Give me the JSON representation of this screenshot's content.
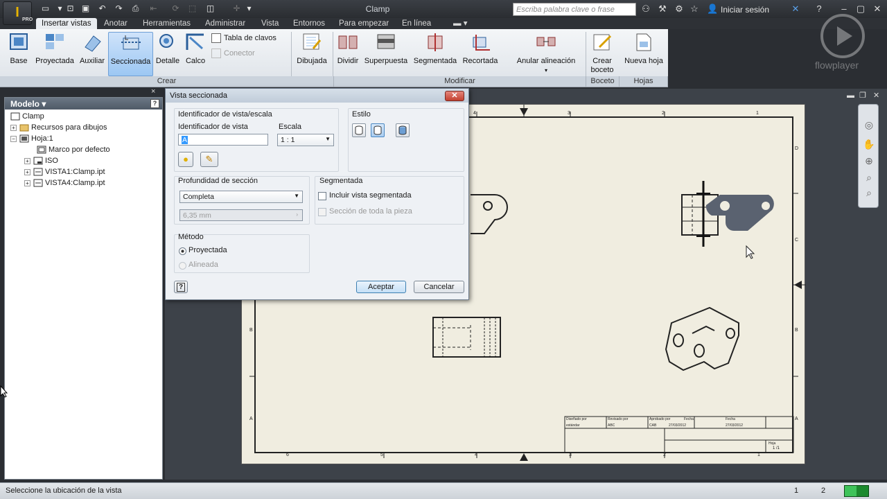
{
  "app": {
    "logo_letter": "I",
    "logo_badge": "PRO",
    "window_title": "Clamp"
  },
  "search": {
    "placeholder": "Escriba palabra clave o frase"
  },
  "signin": "Iniciar sesión",
  "tabs": [
    {
      "label": "Insertar vistas",
      "active": true
    },
    {
      "label": "Anotar"
    },
    {
      "label": "Herramientas"
    },
    {
      "label": "Administrar"
    },
    {
      "label": "Vista"
    },
    {
      "label": "Entornos"
    },
    {
      "label": "Para empezar"
    },
    {
      "label": "En línea"
    }
  ],
  "ribbon": {
    "buttons": [
      "Base",
      "Proyectada",
      "Auxiliar",
      "Seccionada",
      "Detalle",
      "Calco",
      "Dibujada",
      "Dividir",
      "Superpuesta",
      "Segmentada",
      "Recortada",
      "Anular alineación",
      "Crear",
      "boceto",
      "Nueva hoja"
    ],
    "small": [
      "Tabla de clavos",
      "Conector"
    ],
    "groups": [
      "Crear",
      "Modificar",
      "Boceto",
      "Hojas"
    ]
  },
  "watermark": "flowplayer",
  "browser": {
    "title": "Modelo ▾",
    "items": [
      "Clamp",
      "Recursos para dibujos",
      "Hoja:1",
      "Marco por defecto",
      "ISO",
      "VISTA1:Clamp.ipt",
      "VISTA4:Clamp.ipt"
    ]
  },
  "dialog": {
    "title": "Vista seccionada",
    "id_group": "Identificador de vista/escala",
    "id_label": "Identificador de vista",
    "id_value": "A",
    "scale_label": "Escala",
    "scale_value": "1 : 1",
    "style_label": "Estilo",
    "depth_label": "Profundidad de sección",
    "depth_value": "Completa",
    "depth_amount": "6,35 mm",
    "seg_label": "Segmentada",
    "seg_include": "Incluir vista segmentada",
    "seg_whole": "Sección de toda la pieza",
    "method_label": "Método",
    "method_projected": "Proyectada",
    "method_aligned": "Alineada",
    "ok": "Aceptar",
    "cancel": "Cancelar"
  },
  "sheet": {
    "top_numbers": [
      "4",
      "3",
      "2",
      "1"
    ],
    "bottom_numbers": [
      "6",
      "5",
      "4",
      "3",
      "2",
      "1"
    ],
    "right_letters": [
      "D",
      "C",
      "B",
      "A"
    ],
    "left_letters": [
      "B",
      "A"
    ],
    "title_block": {
      "c1": "Diseñado por",
      "c1v": "estándar",
      "c2": "Revisado por",
      "c2v": "ABC",
      "c3": "Aprobado por",
      "c3v": "CAB",
      "c4": "Fecha",
      "c4v": "27/03/2012",
      "c5": "Fecha",
      "c5v": "27/03/2012",
      "sheet": "Hoja",
      "sheet_v": "1 /1"
    }
  },
  "status": {
    "prompt": "Seleccione la ubicación de la vista",
    "n1": "1",
    "n2": "2"
  }
}
